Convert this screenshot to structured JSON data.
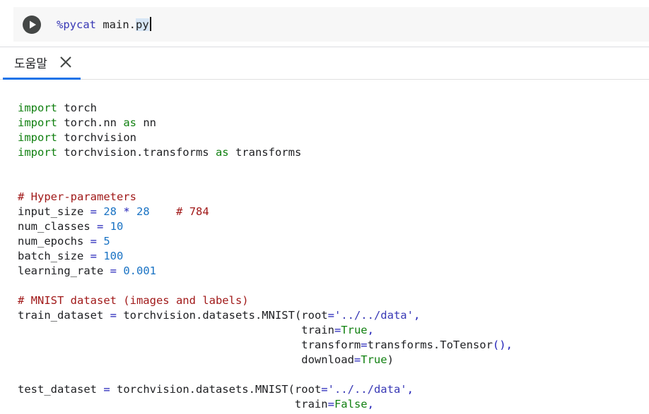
{
  "cell": {
    "magic": "%pycat",
    "argument_before_selection": " main.",
    "argument_selected": "py"
  },
  "help_panel": {
    "tab_label": "도움말"
  },
  "listing_lines": [
    [
      {
        "t": "import",
        "c": "kw"
      },
      {
        "t": " torch",
        "c": ""
      }
    ],
    [
      {
        "t": "import",
        "c": "kw"
      },
      {
        "t": " torch.nn ",
        "c": ""
      },
      {
        "t": "as",
        "c": "kw"
      },
      {
        "t": " nn",
        "c": ""
      }
    ],
    [
      {
        "t": "import",
        "c": "kw"
      },
      {
        "t": " torchvision",
        "c": ""
      }
    ],
    [
      {
        "t": "import",
        "c": "kw"
      },
      {
        "t": " torchvision.transforms ",
        "c": ""
      },
      {
        "t": "as",
        "c": "kw"
      },
      {
        "t": " transforms",
        "c": ""
      }
    ],
    [],
    [],
    [
      {
        "t": "# Hyper-parameters",
        "c": "cm"
      }
    ],
    [
      {
        "t": "input_size ",
        "c": ""
      },
      {
        "t": "=",
        "c": "op"
      },
      {
        "t": " ",
        "c": ""
      },
      {
        "t": "28",
        "c": "nm"
      },
      {
        "t": " ",
        "c": ""
      },
      {
        "t": "*",
        "c": "op"
      },
      {
        "t": " ",
        "c": ""
      },
      {
        "t": "28",
        "c": "nm"
      },
      {
        "t": "    ",
        "c": ""
      },
      {
        "t": "# 784",
        "c": "cm"
      }
    ],
    [
      {
        "t": "num_classes ",
        "c": ""
      },
      {
        "t": "=",
        "c": "op"
      },
      {
        "t": " ",
        "c": ""
      },
      {
        "t": "10",
        "c": "nm"
      }
    ],
    [
      {
        "t": "num_epochs ",
        "c": ""
      },
      {
        "t": "=",
        "c": "op"
      },
      {
        "t": " ",
        "c": ""
      },
      {
        "t": "5",
        "c": "nm"
      }
    ],
    [
      {
        "t": "batch_size ",
        "c": ""
      },
      {
        "t": "=",
        "c": "op"
      },
      {
        "t": " ",
        "c": ""
      },
      {
        "t": "100",
        "c": "nm"
      }
    ],
    [
      {
        "t": "learning_rate ",
        "c": ""
      },
      {
        "t": "=",
        "c": "op"
      },
      {
        "t": " ",
        "c": ""
      },
      {
        "t": "0.001",
        "c": "nm"
      }
    ],
    [],
    [
      {
        "t": "# MNIST dataset (images and labels)",
        "c": "cm"
      }
    ],
    [
      {
        "t": "train_dataset ",
        "c": ""
      },
      {
        "t": "=",
        "c": "op"
      },
      {
        "t": " torchvision.datasets.MNIST(root",
        "c": ""
      },
      {
        "t": "=",
        "c": "op"
      },
      {
        "t": "'../../data'",
        "c": "st"
      },
      {
        "t": ",",
        "c": "op"
      }
    ],
    [
      {
        "t": "                                           train",
        "c": ""
      },
      {
        "t": "=",
        "c": "op"
      },
      {
        "t": "True",
        "c": "bi"
      },
      {
        "t": ",",
        "c": "op"
      }
    ],
    [
      {
        "t": "                                           transform",
        "c": ""
      },
      {
        "t": "=",
        "c": "op"
      },
      {
        "t": "transforms.ToTensor",
        "c": ""
      },
      {
        "t": "(),",
        "c": "op"
      }
    ],
    [
      {
        "t": "                                           download",
        "c": ""
      },
      {
        "t": "=",
        "c": "op"
      },
      {
        "t": "True",
        "c": "bi"
      },
      {
        "t": ")",
        "c": ""
      }
    ],
    [],
    [
      {
        "t": "test_dataset ",
        "c": ""
      },
      {
        "t": "=",
        "c": "op"
      },
      {
        "t": " torchvision.datasets.MNIST(root",
        "c": ""
      },
      {
        "t": "=",
        "c": "op"
      },
      {
        "t": "'../../data'",
        "c": "st"
      },
      {
        "t": ",",
        "c": "op"
      }
    ],
    [
      {
        "t": "                                          train",
        "c": ""
      },
      {
        "t": "=",
        "c": "op"
      },
      {
        "t": "False",
        "c": "bi"
      },
      {
        "t": ",",
        "c": "op"
      }
    ]
  ]
}
